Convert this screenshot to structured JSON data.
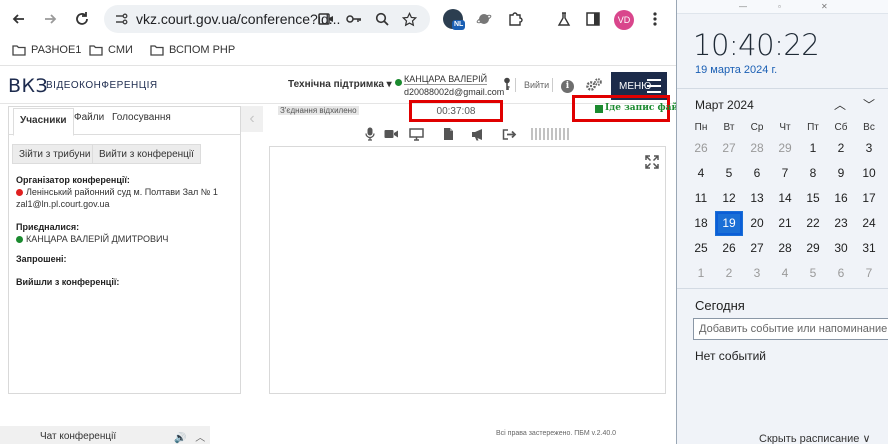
{
  "browser": {
    "url": "vkz.court.gov.ua/conference?id...",
    "extension_badge": "NL",
    "profile_initials": "VD",
    "bookmarks": [
      "РАЗНОЕ1",
      "СМИ",
      "ВСПОМ PHP"
    ]
  },
  "header": {
    "logo": "ВКЗ",
    "logo_sub": "ВІДЕОКОНФЕРЕНЦІЯ",
    "support": "Технічна підтримка ▾",
    "user_name": "КАНЦАРА ВАЛЕРІЙ",
    "user_email": "d20088002d@gmail.com",
    "exit": "Вийти",
    "menu": "МЕНЮ",
    "status_color": "#1b8a2f"
  },
  "left_panel": {
    "tabs": [
      "Учасники",
      "Файли",
      "Голосування"
    ],
    "buttons": [
      "Зійти з трибуни",
      "Вийти з конференції"
    ],
    "organizer_title": "Організатор конференції:",
    "organizer_name": "Ленінський районний суд м. Полтави Зал № 1",
    "organizer_email": "zal1@ln.pl.court.gov.ua",
    "joined_title": "Приєдналися:",
    "joined_name": "КАНЦАРА ВАЛЕРІЙ ДМИТРОВИЧ",
    "invited_title": "Запрошені:",
    "left_title": "Вийшли з конференції:"
  },
  "conference": {
    "status": "З'єднання відхилено",
    "timer": "00:37:08",
    "recording": "Іде запис файлу"
  },
  "footer": {
    "copyright": "Всі права застережено. ПБМ v.2.40.0",
    "chat": "Чат конференції"
  },
  "flyout": {
    "time": "10:40:22",
    "date": "19 марта 2024 г.",
    "month": "Март 2024",
    "weekdays": [
      "Пн",
      "Вт",
      "Ср",
      "Чт",
      "Пт",
      "Сб",
      "Вс"
    ],
    "weeks": [
      [
        "26",
        "27",
        "28",
        "29",
        "1",
        "2",
        "3"
      ],
      [
        "4",
        "5",
        "6",
        "7",
        "8",
        "9",
        "10"
      ],
      [
        "11",
        "12",
        "13",
        "14",
        "15",
        "16",
        "17"
      ],
      [
        "18",
        "19",
        "20",
        "21",
        "22",
        "23",
        "24"
      ],
      [
        "25",
        "26",
        "27",
        "28",
        "29",
        "30",
        "31"
      ],
      [
        "1",
        "2",
        "3",
        "4",
        "5",
        "6",
        "7"
      ]
    ],
    "today": "Сегодня",
    "event_placeholder": "Добавить событие или напоминание",
    "no_events": "Нет событий",
    "hide_schedule": "Скрыть расписание ∨"
  }
}
